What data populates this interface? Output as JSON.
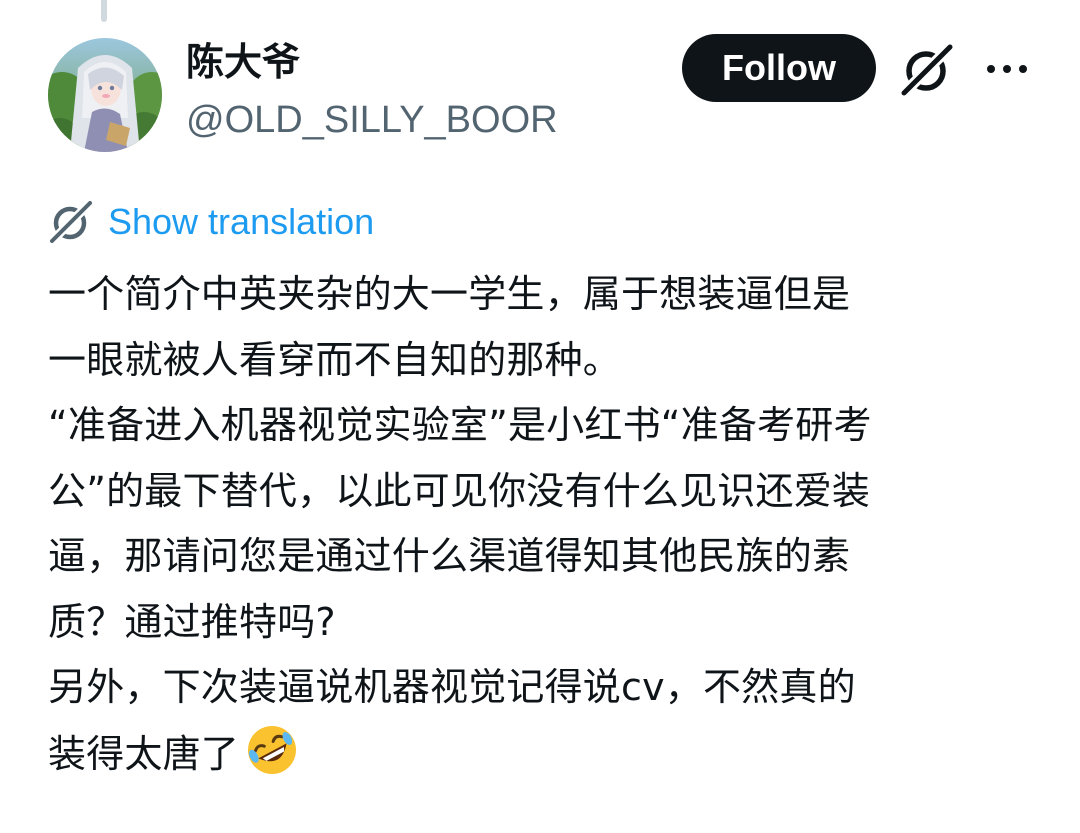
{
  "author": {
    "display_name": "陈大爷",
    "handle": "@OLD_SILLY_BOOR",
    "avatar_icon": "anime-character-avatar"
  },
  "actions": {
    "follow_label": "Follow",
    "grok_icon": "grok-icon",
    "more_icon": "more-dots-icon"
  },
  "translation": {
    "label": "Show translation",
    "icon": "grok-icon"
  },
  "tweet": {
    "lines": [
      "一个简介中英夹杂的大一学生，属于想装逼但是",
      "一眼就被人看穿而不自知的那种。",
      "“准备进入机器视觉实验室”是小红书“准备考研考",
      "公”的最下替代，以此可见你没有什么见识还爱装",
      "逼，那请问您是通过什么渠道得知其他民族的素",
      "质？通过推特吗?",
      "另外，下次装逼说机器视觉记得说cv，不然真的",
      "装得太唐了"
    ],
    "trailing_emoji": "rolling-on-floor-laughing-emoji"
  },
  "colors": {
    "text": "#0f1419",
    "secondary": "#536471",
    "link": "#1d9bf0",
    "button_bg": "#0f1419",
    "button_text": "#ffffff"
  }
}
